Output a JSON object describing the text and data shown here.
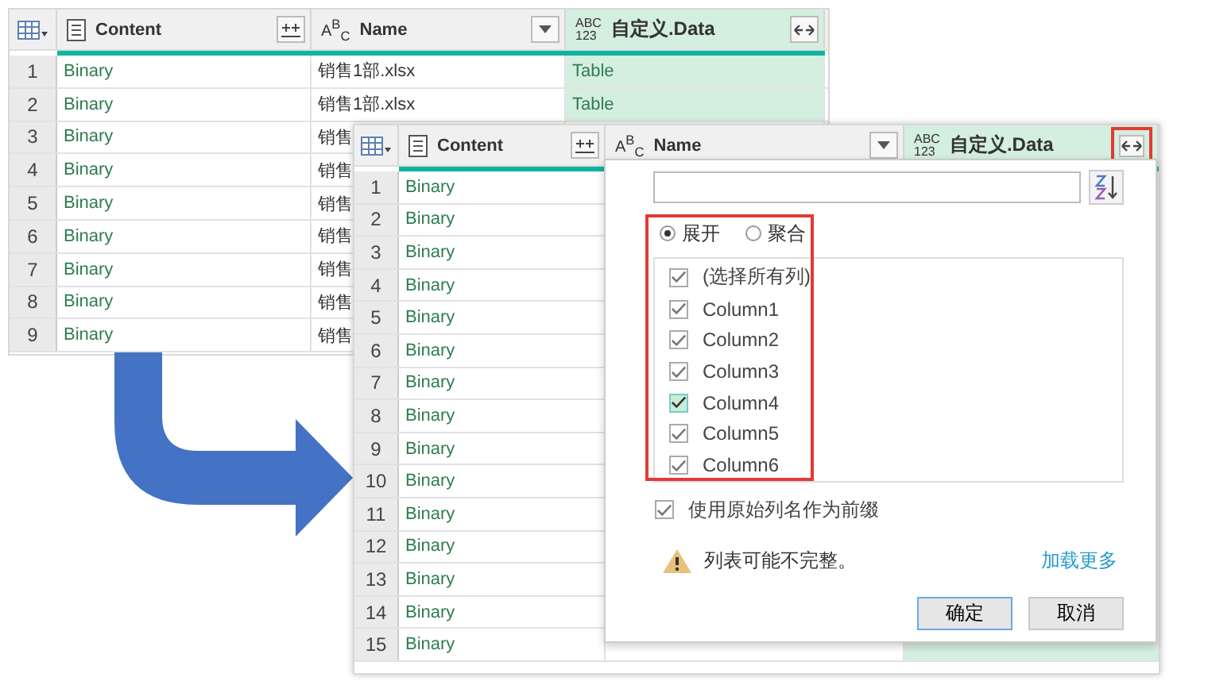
{
  "back_table": {
    "columns": [
      {
        "kind": "content",
        "label": "Content",
        "selected": false
      },
      {
        "kind": "name",
        "label": "Name",
        "type_glyph": [
          "A$^{B}$$_{C}$"
        ],
        "selected": false
      },
      {
        "kind": "data",
        "label": "自定义.Data",
        "type_glyph": [
          "ABC",
          "123"
        ],
        "selected": true
      }
    ],
    "rows": [
      {
        "number": "1",
        "content": "Binary",
        "name": "销售1部.xlsx",
        "data": "Table"
      },
      {
        "number": "2",
        "content": "Binary",
        "name": "销售1部.xlsx",
        "data": "Table"
      },
      {
        "number": "3",
        "content": "Binary",
        "name": "销售"
      },
      {
        "number": "4",
        "content": "Binary",
        "name": "销售"
      },
      {
        "number": "5",
        "content": "Binary",
        "name": "销售"
      },
      {
        "number": "6",
        "content": "Binary",
        "name": "销售"
      },
      {
        "number": "7",
        "content": "Binary",
        "name": "销售"
      },
      {
        "number": "8",
        "content": "Binary",
        "name": "销售"
      },
      {
        "number": "9",
        "content": "Binary",
        "name": "销售"
      }
    ]
  },
  "front_table": {
    "columns": [
      {
        "kind": "content",
        "label": "Content",
        "selected": false
      },
      {
        "kind": "name",
        "label": "Name",
        "type_glyph": [
          "A$^{B}$$_{C}$"
        ],
        "selected": false
      },
      {
        "kind": "data",
        "label": "自定义.Data",
        "type_glyph": [
          "ABC",
          "123"
        ],
        "selected": true,
        "highlighted": true
      }
    ],
    "rows": [
      {
        "number": "1",
        "content": "Binary"
      },
      {
        "number": "2",
        "content": "Binary"
      },
      {
        "number": "3",
        "content": "Binary"
      },
      {
        "number": "4",
        "content": "Binary"
      },
      {
        "number": "5",
        "content": "Binary"
      },
      {
        "number": "6",
        "content": "Binary"
      },
      {
        "number": "7",
        "content": "Binary"
      },
      {
        "number": "8",
        "content": "Binary"
      },
      {
        "number": "9",
        "content": "Binary"
      },
      {
        "number": "10",
        "content": "Binary"
      },
      {
        "number": "11",
        "content": "Binary"
      },
      {
        "number": "12",
        "content": "Binary"
      },
      {
        "number": "13",
        "content": "Binary"
      },
      {
        "number": "14",
        "content": "Binary"
      },
      {
        "number": "15",
        "content": "Binary"
      }
    ]
  },
  "expand_popup": {
    "modes": [
      {
        "label": "展开",
        "selected": true
      },
      {
        "label": "聚合",
        "selected": false
      }
    ],
    "columns": [
      {
        "label": "(选择所有列)",
        "checked": true,
        "hovered": false
      },
      {
        "label": "Column1",
        "checked": true,
        "hovered": false
      },
      {
        "label": "Column2",
        "checked": true,
        "hovered": false
      },
      {
        "label": "Column3",
        "checked": true,
        "hovered": false
      },
      {
        "label": "Column4",
        "checked": true,
        "hovered": true
      },
      {
        "label": "Column5",
        "checked": true,
        "hovered": false
      },
      {
        "label": "Column6",
        "checked": true,
        "hovered": false
      }
    ],
    "prefix_option": {
      "label": "使用原始列名作为前缀",
      "checked": true
    },
    "warning": "列表可能不完整。",
    "load_more": "加载更多",
    "buttons": [
      {
        "label": "确定",
        "kind": "primary"
      },
      {
        "label": "取消",
        "kind": "secondary"
      }
    ]
  }
}
